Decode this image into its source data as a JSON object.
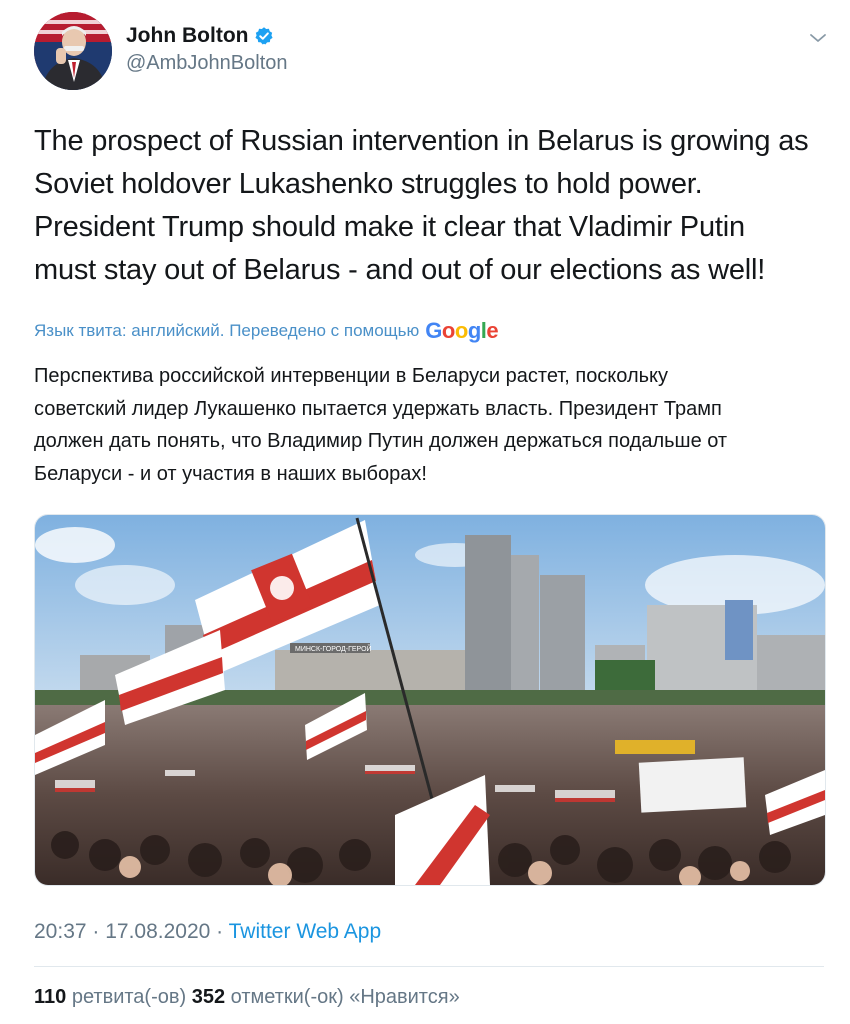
{
  "author": {
    "name": "John Bolton",
    "handle": "@AmbJohnBolton",
    "verified": true,
    "avatar_icon": "avatar-photo"
  },
  "tweet": {
    "text_lines": [
      "The prospect of Russian intervention in Belarus is growing as",
      "Soviet holdover Lukashenko struggles to hold power.",
      "President Trump should make it clear that Vladimir Putin",
      "must stay out of Belarus - and out of our elections as well!"
    ]
  },
  "translation": {
    "label": "Язык твита: английский. Переведено с помощью",
    "provider": "Google",
    "text_lines": [
      "Перспектива российской интервенции в Беларуси растет, поскольку",
      "советский лидер Лукашенко пытается удержать власть. Президент Трамп",
      "должен дать понять, что Владимир Путин должен держаться подальше от",
      "Беларуси - и от участия в наших выборах!"
    ]
  },
  "media": {
    "alt": "",
    "building_sign": "МИНСК-ГОРОД-ГЕРОЙ"
  },
  "meta": {
    "time": "20:37",
    "date": "17.08.2020",
    "separator": " · ",
    "source": "Twitter Web App"
  },
  "stats": {
    "retweets_count": "110",
    "retweets_label": "ретвита(-ов)",
    "likes_count": "352",
    "likes_label": "отметки(-ок) «Нравится»"
  },
  "colors": {
    "link": "#1b95e0",
    "muted": "#657786",
    "text": "#14171a",
    "flag_red": "#d0352f",
    "google_blue": "#4285f4",
    "google_red": "#ea4335",
    "google_yellow": "#fbbc05",
    "google_green": "#34a853"
  }
}
